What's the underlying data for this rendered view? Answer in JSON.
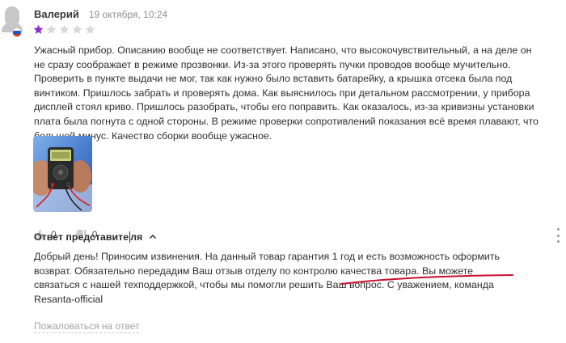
{
  "review": {
    "author": "Валерий",
    "date": "19 октября, 10:24",
    "rating": 1,
    "rating_max": 5,
    "star_color_active": "#8b2fc9",
    "star_color_inactive": "#d9d9d9",
    "text": "Ужасный прибор. Описанию вообще не соответствует. Написано, что высокочувствительный, а на деле он не сразу соображает в режиме прозвонки. Из-за этого проверять пучки проводов вообще мучительно. Проверить в пункте выдачи не мог, так как нужно было вставить батарейку, а крышка отсека была под винтиком. Пришлось забрать и проверять дома. Как выяснилось при детальном рассмотрении, у прибора дисплей стоял криво. Пришлось разобрать, чтобы его поправить. Как оказалось, из-за кривизны установки плата была погнута с одной стороны. В режиме проверки сопротивлений показания всё время плавают, что большой минус. Качество сборки вообще ужасное.",
    "likes": "0",
    "dislikes": "0",
    "icons": {
      "avatar": "user-avatar-icon",
      "flag": "russia-flag-icon",
      "like": "thumb-up-icon",
      "dislike": "thumb-down-icon",
      "more": "more-vertical-icon"
    }
  },
  "reply": {
    "title_part1": "Ответ представите",
    "title_part2": "ля",
    "toggle_icon": "chevron-up-icon",
    "text": "Добрый день! Приносим извинения. На данный товар гарантия 1 год и есть возможность оформить возврат. Обязательно передадим Ваш отзыв отделу по контролю качества товара. Вы можете связаться с нашей техподдержкой, чтобы мы помогли решить Ваш вопрос. С уважением, команда Resanta-official",
    "complain_label": "Пожаловаться на ответ",
    "annotation_color": "#c8102e"
  }
}
